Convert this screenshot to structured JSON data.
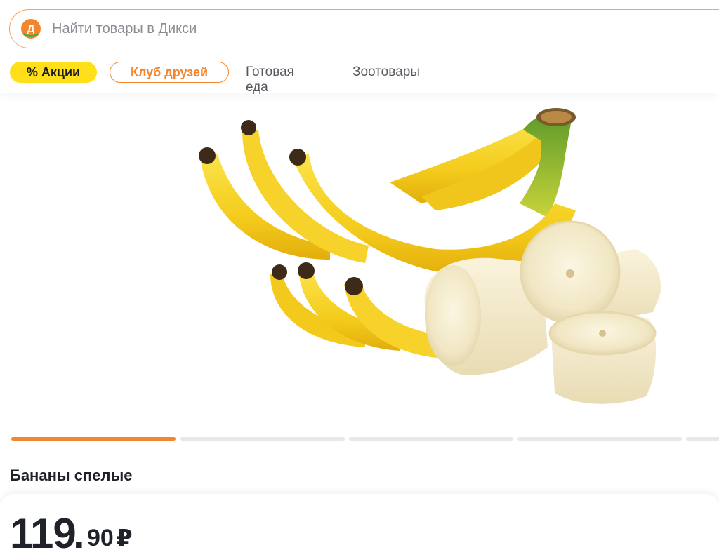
{
  "search": {
    "placeholder": "Найти товары в Дикси",
    "logo_letter": "Д"
  },
  "nav": {
    "promo_label": "% Акции",
    "club_label": "Клуб друзей",
    "links": [
      "Готовая еда",
      "Зоотовары"
    ]
  },
  "gallery": {
    "slides_visible": 5,
    "active_index": 0
  },
  "product": {
    "name": "Бананы спелые",
    "price_integer": "119",
    "price_sep": ".",
    "price_fraction": "90",
    "currency": "₽"
  },
  "colors": {
    "accent_orange": "#f2862e",
    "promo_yellow": "#ffde1a",
    "logo_green": "#3cb24a"
  }
}
